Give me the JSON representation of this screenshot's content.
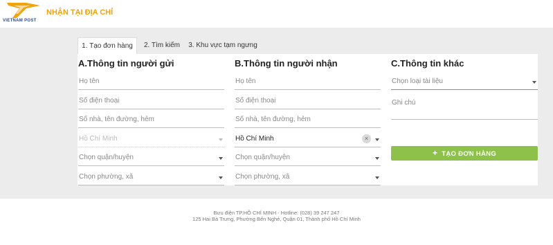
{
  "header": {
    "logo_text": "VIETNAM POST",
    "title": "NHẬN TẠI ĐỊA CHỈ"
  },
  "tabs": [
    {
      "label": "1. Tạo đơn hàng",
      "active": true
    },
    {
      "label": "2. Tìm kiếm",
      "active": false
    },
    {
      "label": "3. Khu vực tạm ngưng",
      "active": false
    }
  ],
  "sender": {
    "title": "A.Thông tin người gửi",
    "name_placeholder": "Họ tên",
    "phone_placeholder": "Số điện thoại",
    "address_placeholder": "Số nhà, tên đường, hẻm",
    "province_value": "Hồ Chí Minh",
    "district_placeholder": "Chọn quận/huyện",
    "ward_placeholder": "Chọn phường, xã"
  },
  "receiver": {
    "title": "B.Thông tin người nhận",
    "name_placeholder": "Họ tên",
    "phone_placeholder": "Số điện thoại",
    "address_placeholder": "Số nhà, tên đường, hẻm",
    "province_value": "Hồ Chí Minh",
    "clear_icon": "×",
    "district_placeholder": "Chọn quận/huyện",
    "ward_placeholder": "Chọn phường, xã"
  },
  "other": {
    "title": "C.Thông tin khác",
    "doc_type_placeholder": "Chọn loại tài liệu",
    "note_placeholder": "Ghi chú",
    "submit_icon": "+",
    "submit_label": "TẠO ĐƠN HÀNG"
  },
  "footer": {
    "line1": "Bưu điện TP.HỒ CHÍ MINH - Hotline: (028) 39 247 247",
    "line2": "125 Hai Bà Trưng, Phường Bến Nghé, Quận 01, Thành phố Hồ Chí Minh"
  },
  "colors": {
    "brand_orange": "#f0a30a",
    "brand_blue": "#2b4a8a",
    "submit_green": "#8dc149",
    "accent_underline": "#e8702a"
  }
}
